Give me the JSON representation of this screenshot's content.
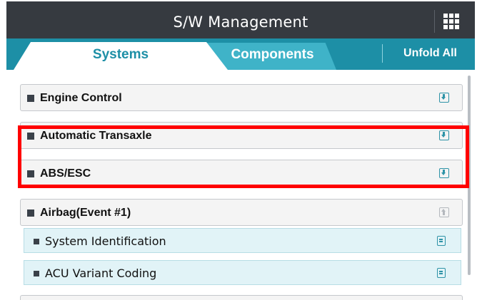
{
  "header": {
    "title": "S/W Management",
    "menu_icon": "grid-menu-icon"
  },
  "tabs": [
    {
      "label": "Systems",
      "active": true
    },
    {
      "label": "Components",
      "active": false
    }
  ],
  "toolbar": {
    "unfold_all_label": "Unfold All"
  },
  "systems": [
    {
      "label": "Engine Control",
      "expanded": false,
      "icon": "download-icon"
    },
    {
      "label": "Automatic Transaxle",
      "expanded": false,
      "icon": "download-icon"
    },
    {
      "label": "ABS/ESC",
      "expanded": false,
      "icon": "download-icon"
    },
    {
      "label": "Airbag(Event #1)",
      "expanded": true,
      "icon": "upload-icon",
      "children": [
        {
          "label": "System Identification",
          "icon": "document-icon"
        },
        {
          "label": "ACU Variant Coding",
          "icon": "document-icon"
        }
      ]
    }
  ],
  "colors": {
    "header_bg": "#363a40",
    "tabbar_bg": "#1d8fa6",
    "inactive_tab": "#3fb3c8",
    "accent": "#2e93a7",
    "highlight": "#ff0000",
    "sub_row_bg": "#e1f3f7"
  }
}
